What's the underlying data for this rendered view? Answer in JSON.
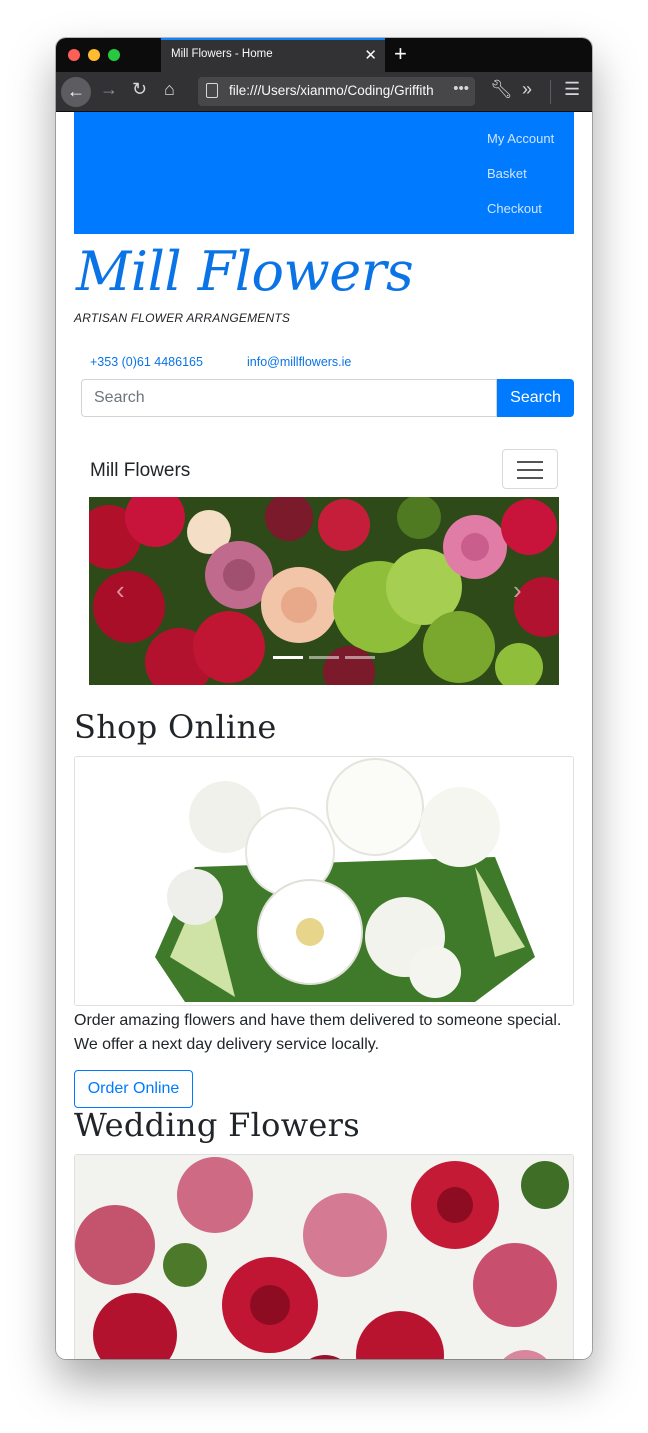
{
  "browser": {
    "tab_title": "Mill Flowers - Home",
    "url": "file:///Users/xianmo/Coding/Griffith",
    "tab_close_icon": "close-icon",
    "new_tab_icon": "plus-icon"
  },
  "site": {
    "top_links": [
      "My Account",
      "Basket",
      "Checkout"
    ],
    "logo": "Mill Flowers",
    "tagline": "ARTISAN FLOWER ARRANGEMENTS",
    "phone": "+353 (0)61 4486165",
    "email": "info@millflowers.ie",
    "search_placeholder": "Search",
    "search_button": "Search",
    "brand": "Mill Flowers",
    "carousel": {
      "slide_count": 3,
      "active_slide": 1
    },
    "shop": {
      "title": "Shop Online",
      "text": "Order amazing flowers and have them delivered to someone special. We offer a next day delivery service locally.",
      "button": "Order Online"
    },
    "wedding": {
      "title": "Wedding Flowers"
    },
    "colors": {
      "primary": "#007bff",
      "logo": "#0a74e6"
    }
  }
}
